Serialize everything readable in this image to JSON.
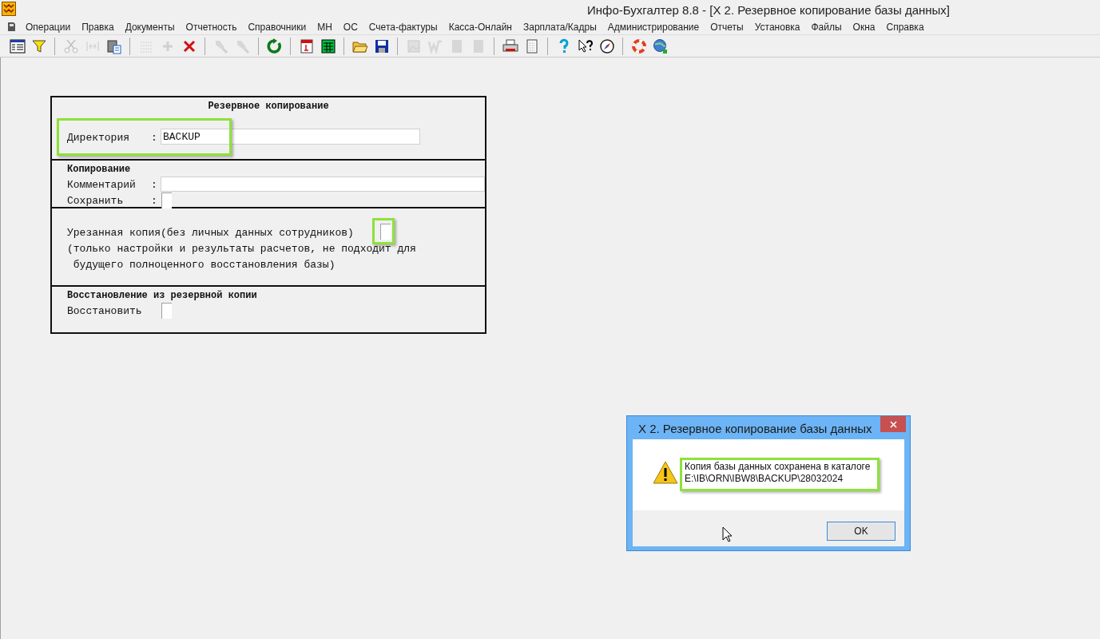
{
  "window": {
    "title": "Инфо-Бухгалтер 8.8 - [X 2. Резервное копирование базы данных]"
  },
  "menu": [
    "Операции",
    "Правка",
    "Документы",
    "Отчетность",
    "Справочники",
    "МН",
    "ОС",
    "Счета-фактуры",
    "Касса-Онлайн",
    "Зарплата/Кадры",
    "Администрирование",
    "Отчеты",
    "Установка",
    "Файлы",
    "Окна",
    "Справка"
  ],
  "toolbar": [
    {
      "kind": "grid",
      "disabled": false
    },
    {
      "kind": "filter",
      "disabled": false
    },
    {
      "kind": "separator"
    },
    {
      "kind": "scissors",
      "disabled": true
    },
    {
      "kind": "tool",
      "disabled": true
    },
    {
      "kind": "clipboard",
      "disabled": false
    },
    {
      "kind": "separator"
    },
    {
      "kind": "counter",
      "disabled": true
    },
    {
      "kind": "plus",
      "disabled": true
    },
    {
      "kind": "cross",
      "disabled": false
    },
    {
      "kind": "separator"
    },
    {
      "kind": "torch",
      "disabled": true
    },
    {
      "kind": "torch",
      "disabled": true
    },
    {
      "kind": "separator"
    },
    {
      "kind": "refresh",
      "disabled": false
    },
    {
      "kind": "separator"
    },
    {
      "kind": "calendar",
      "disabled": false
    },
    {
      "kind": "calculator",
      "disabled": false
    },
    {
      "kind": "separator"
    },
    {
      "kind": "folder",
      "disabled": false
    },
    {
      "kind": "disk",
      "disabled": false
    },
    {
      "kind": "separator"
    },
    {
      "kind": "image",
      "disabled": true
    },
    {
      "kind": "letter",
      "disabled": true
    },
    {
      "kind": "block",
      "disabled": true
    },
    {
      "kind": "block",
      "disabled": true
    },
    {
      "kind": "separator"
    },
    {
      "kind": "printer",
      "disabled": false
    },
    {
      "kind": "page",
      "disabled": false
    },
    {
      "kind": "separator"
    },
    {
      "kind": "help",
      "disabled": false
    },
    {
      "kind": "pointer-help",
      "disabled": false
    },
    {
      "kind": "compass",
      "disabled": false
    },
    {
      "kind": "separator"
    },
    {
      "kind": "lifebuoy",
      "disabled": false
    },
    {
      "kind": "globe",
      "disabled": false
    }
  ],
  "form": {
    "title": "Резервное копирование",
    "directory": {
      "label": "Директория",
      "colon": ":",
      "value": "BACKUP",
      "highlighted": true
    },
    "copy_section": {
      "title": "Копирование",
      "comment": {
        "label": "Комментарий",
        "colon": ":"
      },
      "save": {
        "label": "Сохранить",
        "colon": ":",
        "checked": false
      }
    },
    "truncated": {
      "label": "Урезанная копия(без личных данных сотрудников)",
      "checked": false,
      "highlighted": true,
      "note_lines": [
        "(только настройки и результаты расчетов, не подходит для",
        " будущего полноценного восстановления базы)"
      ]
    },
    "restore_section": {
      "title": "Восстановление из резервной копии",
      "restore": {
        "label": "Восстановить",
        "checked": false
      }
    }
  },
  "dialog": {
    "title": "X 2. Резервное копирование базы данных",
    "message_lines": [
      "Копия базы данных сохранена в каталоге",
      "E:\\IB\\ORN\\IBW8\\BACKUP\\28032024"
    ],
    "highlighted": true,
    "button": "OK"
  }
}
